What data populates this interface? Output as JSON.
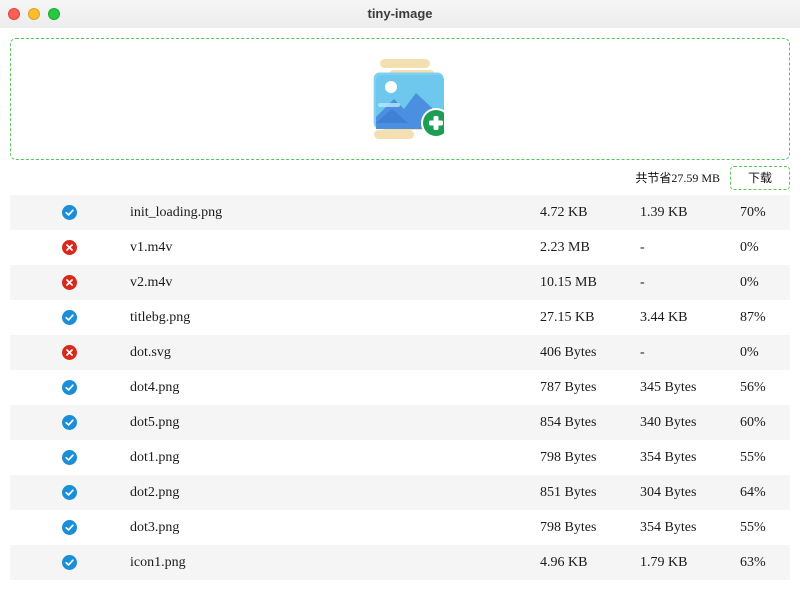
{
  "window": {
    "title": "tiny-image"
  },
  "dropzone": {
    "icon": "add-image-icon"
  },
  "summary": {
    "text": "共节省27.59 MB",
    "download_label": "下载"
  },
  "colors": {
    "success": "#1a8fd8",
    "error": "#d9291c",
    "accent_border": "#5cc35c",
    "row_alt": "#f5f5f5"
  },
  "files": [
    {
      "status": "success",
      "name": "init_loading.png",
      "original": "4.72 KB",
      "compressed": "1.39 KB",
      "saved": "70%"
    },
    {
      "status": "error",
      "name": "v1.m4v",
      "original": "2.23 MB",
      "compressed": "-",
      "saved": "0%"
    },
    {
      "status": "error",
      "name": "v2.m4v",
      "original": "10.15 MB",
      "compressed": "-",
      "saved": "0%"
    },
    {
      "status": "success",
      "name": "titlebg.png",
      "original": "27.15 KB",
      "compressed": "3.44 KB",
      "saved": "87%"
    },
    {
      "status": "error",
      "name": "dot.svg",
      "original": "406 Bytes",
      "compressed": "-",
      "saved": "0%"
    },
    {
      "status": "success",
      "name": "dot4.png",
      "original": "787 Bytes",
      "compressed": "345 Bytes",
      "saved": "56%"
    },
    {
      "status": "success",
      "name": "dot5.png",
      "original": "854 Bytes",
      "compressed": "340 Bytes",
      "saved": "60%"
    },
    {
      "status": "success",
      "name": "dot1.png",
      "original": "798 Bytes",
      "compressed": "354 Bytes",
      "saved": "55%"
    },
    {
      "status": "success",
      "name": "dot2.png",
      "original": "851 Bytes",
      "compressed": "304 Bytes",
      "saved": "64%"
    },
    {
      "status": "success",
      "name": "dot3.png",
      "original": "798 Bytes",
      "compressed": "354 Bytes",
      "saved": "55%"
    },
    {
      "status": "success",
      "name": "icon1.png",
      "original": "4.96 KB",
      "compressed": "1.79 KB",
      "saved": "63%"
    }
  ]
}
